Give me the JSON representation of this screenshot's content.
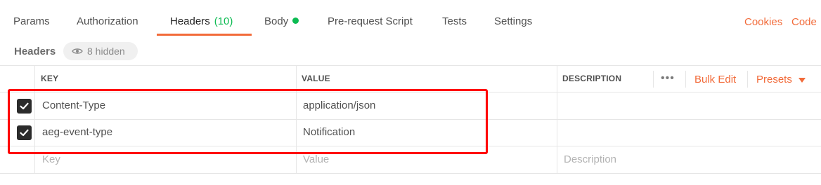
{
  "tabs": {
    "params": "Params",
    "authorization": "Authorization",
    "headers": "Headers",
    "headers_count": "(10)",
    "body": "Body",
    "prerequest": "Pre-request Script",
    "tests": "Tests",
    "settings": "Settings",
    "cookies": "Cookies",
    "code": "Code"
  },
  "section": {
    "title": "Headers",
    "hidden_label": "8 hidden"
  },
  "table": {
    "columns": {
      "key": "KEY",
      "value": "VALUE",
      "description": "DESCRIPTION"
    },
    "actions": {
      "more": "•••",
      "bulk_edit": "Bulk Edit",
      "presets": "Presets"
    },
    "rows": [
      {
        "checked": true,
        "key": "Content-Type",
        "value": "application/json",
        "description": ""
      },
      {
        "checked": true,
        "key": "aeg-event-type",
        "value": "Notification",
        "description": ""
      }
    ],
    "new_row": {
      "key_placeholder": "Key",
      "value_placeholder": "Value",
      "description_placeholder": "Description"
    }
  },
  "colors": {
    "accent": "#f26b3a",
    "success": "#0cbb52",
    "annotation": "#ff0000"
  }
}
